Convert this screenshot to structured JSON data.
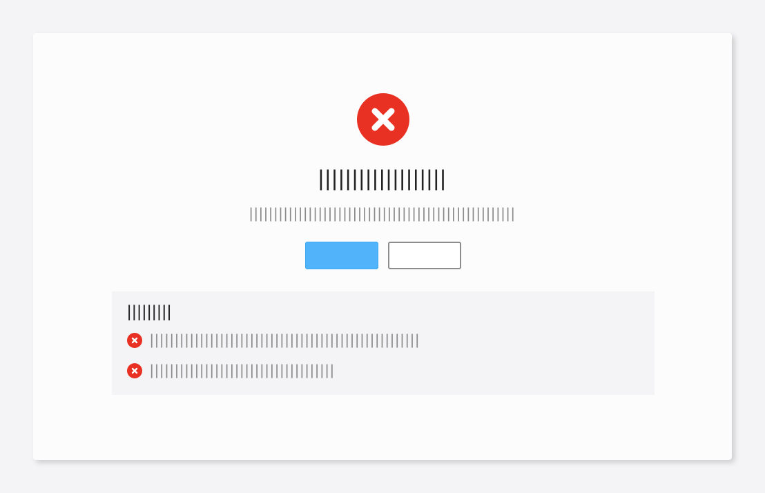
{
  "result": {
    "icon": "close-circle-icon",
    "status_color": "#e83122",
    "title": "|||||||||||||||||||",
    "subtitle": "||||||||||||||||||||||||||||||||||||||||||||||||||||||",
    "primary_button_label": "",
    "secondary_button_label": "",
    "primary_color": "#51b4fb"
  },
  "details": {
    "heading": "|||||||||",
    "items": [
      {
        "icon": "close-circle-icon",
        "text": "||||||||||||||||||||||||||||||||||||||||||||||||||||||"
      },
      {
        "icon": "close-circle-icon",
        "text": "|||||||||||||||||||||||||||||||||||||"
      }
    ]
  }
}
